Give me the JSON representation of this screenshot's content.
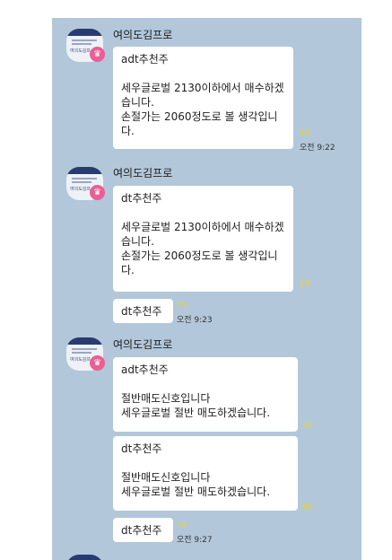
{
  "messages": [
    {
      "sender": "여의도김프로",
      "avatar_label": "여의도김프",
      "badge_icon": "crown-icon",
      "bubbles": [
        {
          "text": "adt추천주\n\n세우글로벌 2130이하에서 매수하겠습니다.\n손절가는 2060정도로 볼 생각입니다.",
          "unread": "15",
          "time": "오전 9:22"
        }
      ]
    },
    {
      "sender": "여의도김프로",
      "avatar_label": "여의도김프",
      "badge_icon": "crown-icon",
      "bubbles": [
        {
          "text": "dt추천주\n\n세우글로벌 2130이하에서 매수하겠습니다.\n손절가는 2060정도로 볼 생각입니다.",
          "unread": "15",
          "time": ""
        },
        {
          "text": "dt추천주",
          "unread": "15",
          "time": "오전 9:23"
        }
      ]
    },
    {
      "sender": "여의도김프로",
      "avatar_label": "여의도김프",
      "badge_icon": "crown-icon",
      "bubbles": [
        {
          "text": "adt추천주\n\n절반매도신호입니다\n세우글로벌 절반 매도하겠습니다.",
          "unread": "15",
          "time": ""
        },
        {
          "text": "dt추천주\n\n절반매도신호입니다\n세우글로벌 절반 매도하겠습니다.",
          "unread": "15",
          "time": ""
        },
        {
          "text": "dt추천주",
          "unread": "15",
          "time": "오전 9:27"
        }
      ]
    }
  ],
  "colors": {
    "chat_background": "#b2c7d9",
    "bubble": "#ffffff",
    "unread": "#f5d400",
    "badge": "#ea5e95"
  }
}
